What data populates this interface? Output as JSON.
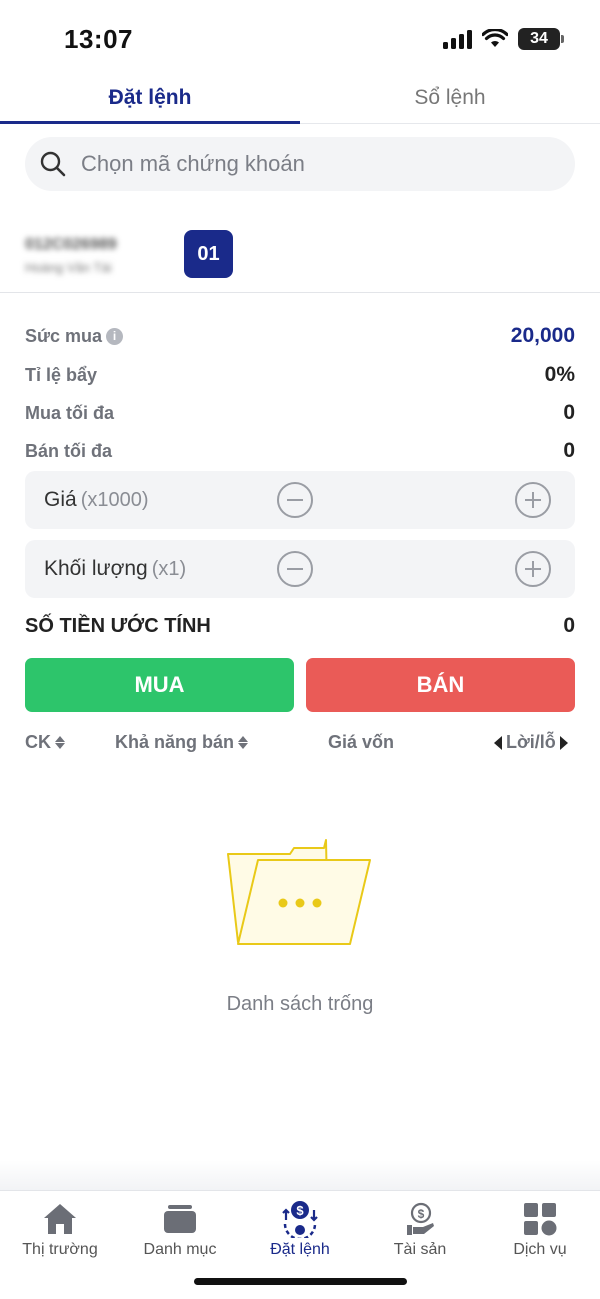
{
  "status_bar": {
    "time": "13:07",
    "battery": "34"
  },
  "tabs": [
    {
      "label": "Đặt lệnh",
      "active": true
    },
    {
      "label": "Sổ lệnh",
      "active": false
    }
  ],
  "search": {
    "placeholder": "Chọn mã chứng khoán"
  },
  "account": {
    "id": "012C026989",
    "name": "Hoàng Văn Tài",
    "sub_account": "01"
  },
  "info": {
    "buying_power": {
      "label": "Sức mua",
      "value": "20,000"
    },
    "leverage": {
      "label": "Tỉ lệ bẩy",
      "value": "0%"
    },
    "max_buy": {
      "label": "Mua tối đa",
      "value": "0"
    },
    "max_sell": {
      "label": "Bán tối đa",
      "value": "0"
    }
  },
  "inputs": {
    "price": {
      "label": "Giá",
      "unit": "(x1000)"
    },
    "volume": {
      "label": "Khối lượng",
      "unit": "(x1)"
    }
  },
  "estimate": {
    "label": "SỐ TIỀN ƯỚC TÍNH",
    "value": "0"
  },
  "actions": {
    "buy": "MUA",
    "sell": "BÁN"
  },
  "table": {
    "col_ck": "CK",
    "col_sellable": "Khả năng bán",
    "col_cost": "Giá vốn",
    "col_pl": "Lời/lỗ"
  },
  "empty": {
    "text": "Danh sách trống"
  },
  "bottom_nav": [
    {
      "label": "Thị trường",
      "icon": "home-icon"
    },
    {
      "label": "Danh mục",
      "icon": "portfolio-icon"
    },
    {
      "label": "Đặt lệnh",
      "icon": "order-icon",
      "active": true
    },
    {
      "label": "Tài sản",
      "icon": "assets-icon"
    },
    {
      "label": "Dịch vụ",
      "icon": "services-icon"
    }
  ],
  "colors": {
    "primary": "#1a2a8a",
    "buy": "#2dc56b",
    "sell": "#ea5b57"
  }
}
